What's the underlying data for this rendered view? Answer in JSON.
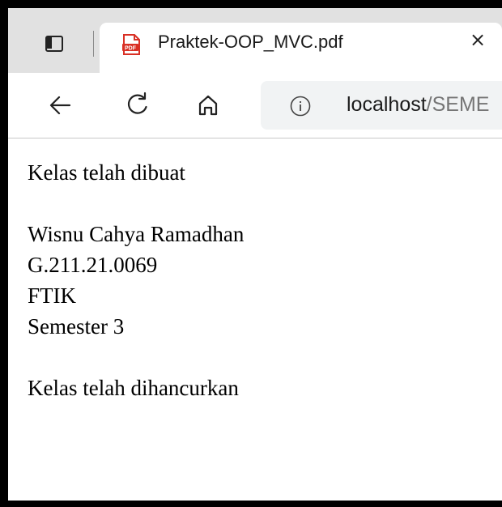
{
  "browser": {
    "tab": {
      "title": "Praktek-OOP_MVC.pdf",
      "close_glyph": "×",
      "icon": "pdf-icon",
      "icon_text": "PDF"
    },
    "toolbar": {
      "back_icon": "back-arrow-icon",
      "reload_icon": "reload-icon",
      "home_icon": "home-icon"
    },
    "address": {
      "info_icon": "info-icon",
      "host": "localhost",
      "path": "/SEME"
    }
  },
  "page": {
    "line1": "Kelas telah dibuat",
    "name": "Wisnu Cahya Ramadhan",
    "nim": "G.211.21.0069",
    "faculty": "FTIK",
    "semester": "Semester 3",
    "line_end": "Kelas telah dihancurkan"
  },
  "colors": {
    "tabbar_bg": "#e1e1e1",
    "address_bg": "#f1f3f4",
    "pdf_red": "#d93025"
  }
}
